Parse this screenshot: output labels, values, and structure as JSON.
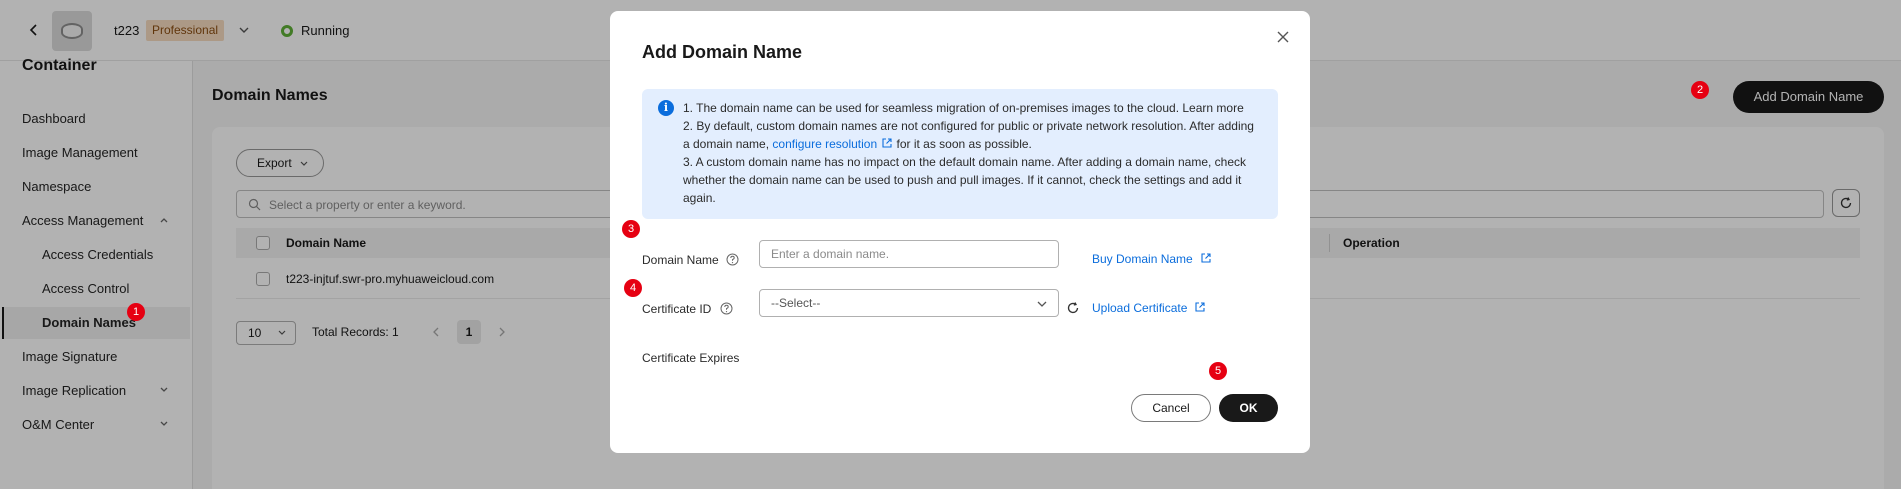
{
  "header": {
    "instance_name": "t223",
    "edition_badge": "Professional",
    "status": "Running",
    "status_color": "#5fb037"
  },
  "sidebar": {
    "title": "Container",
    "items": [
      {
        "label": "Dashboard"
      },
      {
        "label": "Image Management"
      },
      {
        "label": "Namespace"
      },
      {
        "label": "Access Management"
      },
      {
        "label": "Access Credentials"
      },
      {
        "label": "Access Control"
      },
      {
        "label": "Domain Names"
      },
      {
        "label": "Image Signature"
      },
      {
        "label": "Image Replication"
      },
      {
        "label": "O&M Center"
      }
    ]
  },
  "main": {
    "title": "Domain Names",
    "add_button": "Add Domain Name",
    "export_button": "Export",
    "search_placeholder": "Select a property or enter a keyword.",
    "columns": {
      "domain_name": "Domain Name",
      "operation": "Operation"
    },
    "rows": [
      {
        "domain_name": "t223-injtuf.swr-pro.myhuaweicloud.com"
      }
    ],
    "pagination": {
      "page_size": "10",
      "total": "Total Records: 1",
      "current_page": "1"
    }
  },
  "dialog": {
    "title": "Add Domain Name",
    "info": {
      "line1": "1. The domain name can be used for seamless migration of on-premises images to the cloud. Learn more",
      "line2": "2. By default, custom domain names are not configured for public or private network resolution. After adding",
      "line3_pre": "a domain name,",
      "line3_link": "configure resolution",
      "line3_post": "for it as soon as possible.",
      "line4": "3. A custom domain name has no impact on the default domain name. After adding a domain name, check",
      "line5": "whether the domain name can be used to push and pull images. If it cannot, check the settings and add it",
      "line6": "again."
    },
    "domain_label": "Domain Name",
    "domain_placeholder": "Enter a domain name.",
    "buy_link": "Buy Domain Name",
    "cert_label": "Certificate ID",
    "cert_value": "--Select--",
    "upload_link": "Upload Certificate",
    "cert_expires_label": "Certificate Expires",
    "cancel": "Cancel",
    "ok": "OK"
  },
  "markers": [
    "1",
    "2",
    "3",
    "4",
    "5"
  ],
  "colors": {
    "accent": "#0b6ddc",
    "primary_button": "#191919",
    "marker": "#e60012"
  }
}
